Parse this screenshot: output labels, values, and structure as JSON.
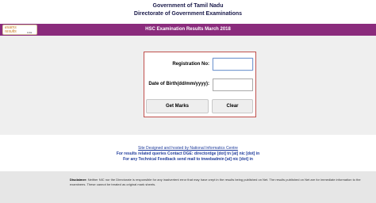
{
  "header": {
    "line1": "Government of Tamil Nadu",
    "line2": "Directorate of Government Examinations"
  },
  "banner": {
    "logo_line1": "exams",
    "logo_line2": "results",
    "logo_line3": "india",
    "title": "HSC  Examination Results  March 2018",
    "color": "#8a2b7c"
  },
  "form": {
    "registration_label": "Registration No:",
    "registration_value": "",
    "dob_label": "Date of Birth(dd/mm/yyyy):",
    "dob_value": "",
    "get_marks_label": "Get Marks",
    "clear_label": "Clear",
    "border_color": "#c0504d"
  },
  "footer": {
    "nic_link": "Site Designed and hosted by National Informatics Centre",
    "queries": "For results related queries Contact DGE:  directordge [dot] tn [at] nic [dot] in",
    "feedback": "For any Technical Feedback send mail to tnwebadmin [at] nic [dot] in"
  },
  "disclaimer": {
    "label": "Disclaimer:",
    "text": " Neither NIC nor the Directorate is responsible for any inadvertent error that may have crept in the results being published on Net. The results published on Net are for immediate information to the examinees. These cannot be treated as original mark sheets."
  }
}
